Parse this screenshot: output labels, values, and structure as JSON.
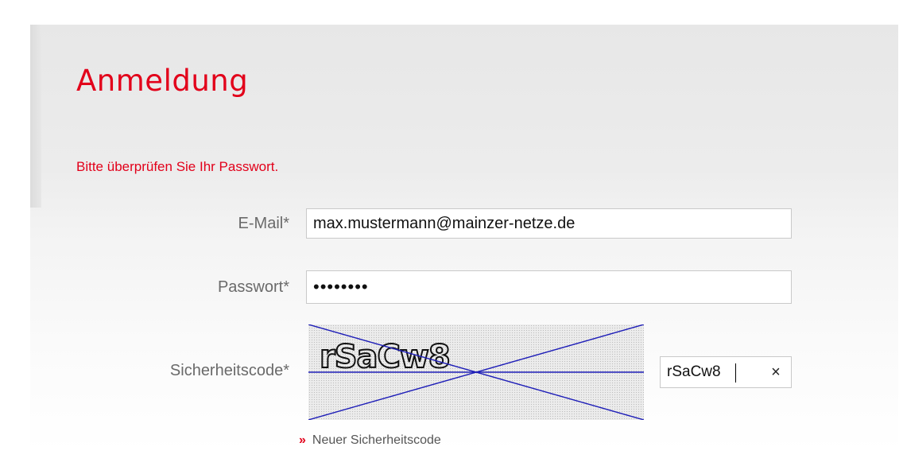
{
  "form": {
    "title": "Anmeldung",
    "error_message": "Bitte überprüfen Sie Ihr Passwort.",
    "email": {
      "label": "E-Mail*",
      "value": "max.mustermann@mainzer-netze.de"
    },
    "password": {
      "label": "Passwort*",
      "value": "••••••••"
    },
    "captcha": {
      "label": "Sicherheitscode*",
      "image_text": "rSaCw8",
      "value": "rSaCw8",
      "clear_icon": "×",
      "refresh_link_icon": "»",
      "refresh_link_label": "Neuer Sicherheitscode"
    }
  },
  "colors": {
    "accent": "#e2001a",
    "label": "#6a6a6a",
    "captcha_lines": "#1f1fb8"
  }
}
